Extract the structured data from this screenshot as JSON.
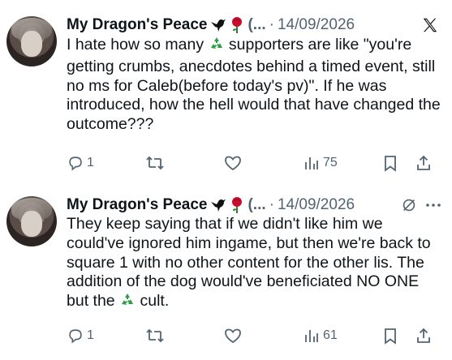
{
  "tweets": [
    {
      "author": "My Dragon's Peace",
      "handle_truncated": "(...",
      "date": "14/09/2026",
      "text_parts": [
        "I hate how so many ",
        " supporters are like \"you're getting crumbs, anecdotes behind a timed event, still no ms for Caleb(before today's pv)\". If he was introduced, how the hell would that have changed the outcome???"
      ],
      "reply_count": "1",
      "view_count": "75",
      "corner_icon": "x-logo-icon"
    },
    {
      "author": "My Dragon's Peace",
      "handle_truncated": "(...",
      "date": "14/09/2026",
      "text_parts": [
        "They keep saying that if we didn't like him we could've ignored him ingame, but then we're back to square 1 with no other content for the other lis. The addition of the dog would've beneficiated NO ONE but the ",
        " cult."
      ],
      "reply_count": "1",
      "view_count": "61",
      "corner_icon": "grok-icon"
    }
  ],
  "separator": "·",
  "icons": {
    "name_emojis": [
      "black-bird-icon",
      "rose-icon"
    ],
    "inline_emoji": "recycling-icon"
  },
  "colors": {
    "text": "#0f1419",
    "muted": "#536471",
    "recycle": "#2e9e45",
    "rose": "#c8102e"
  }
}
